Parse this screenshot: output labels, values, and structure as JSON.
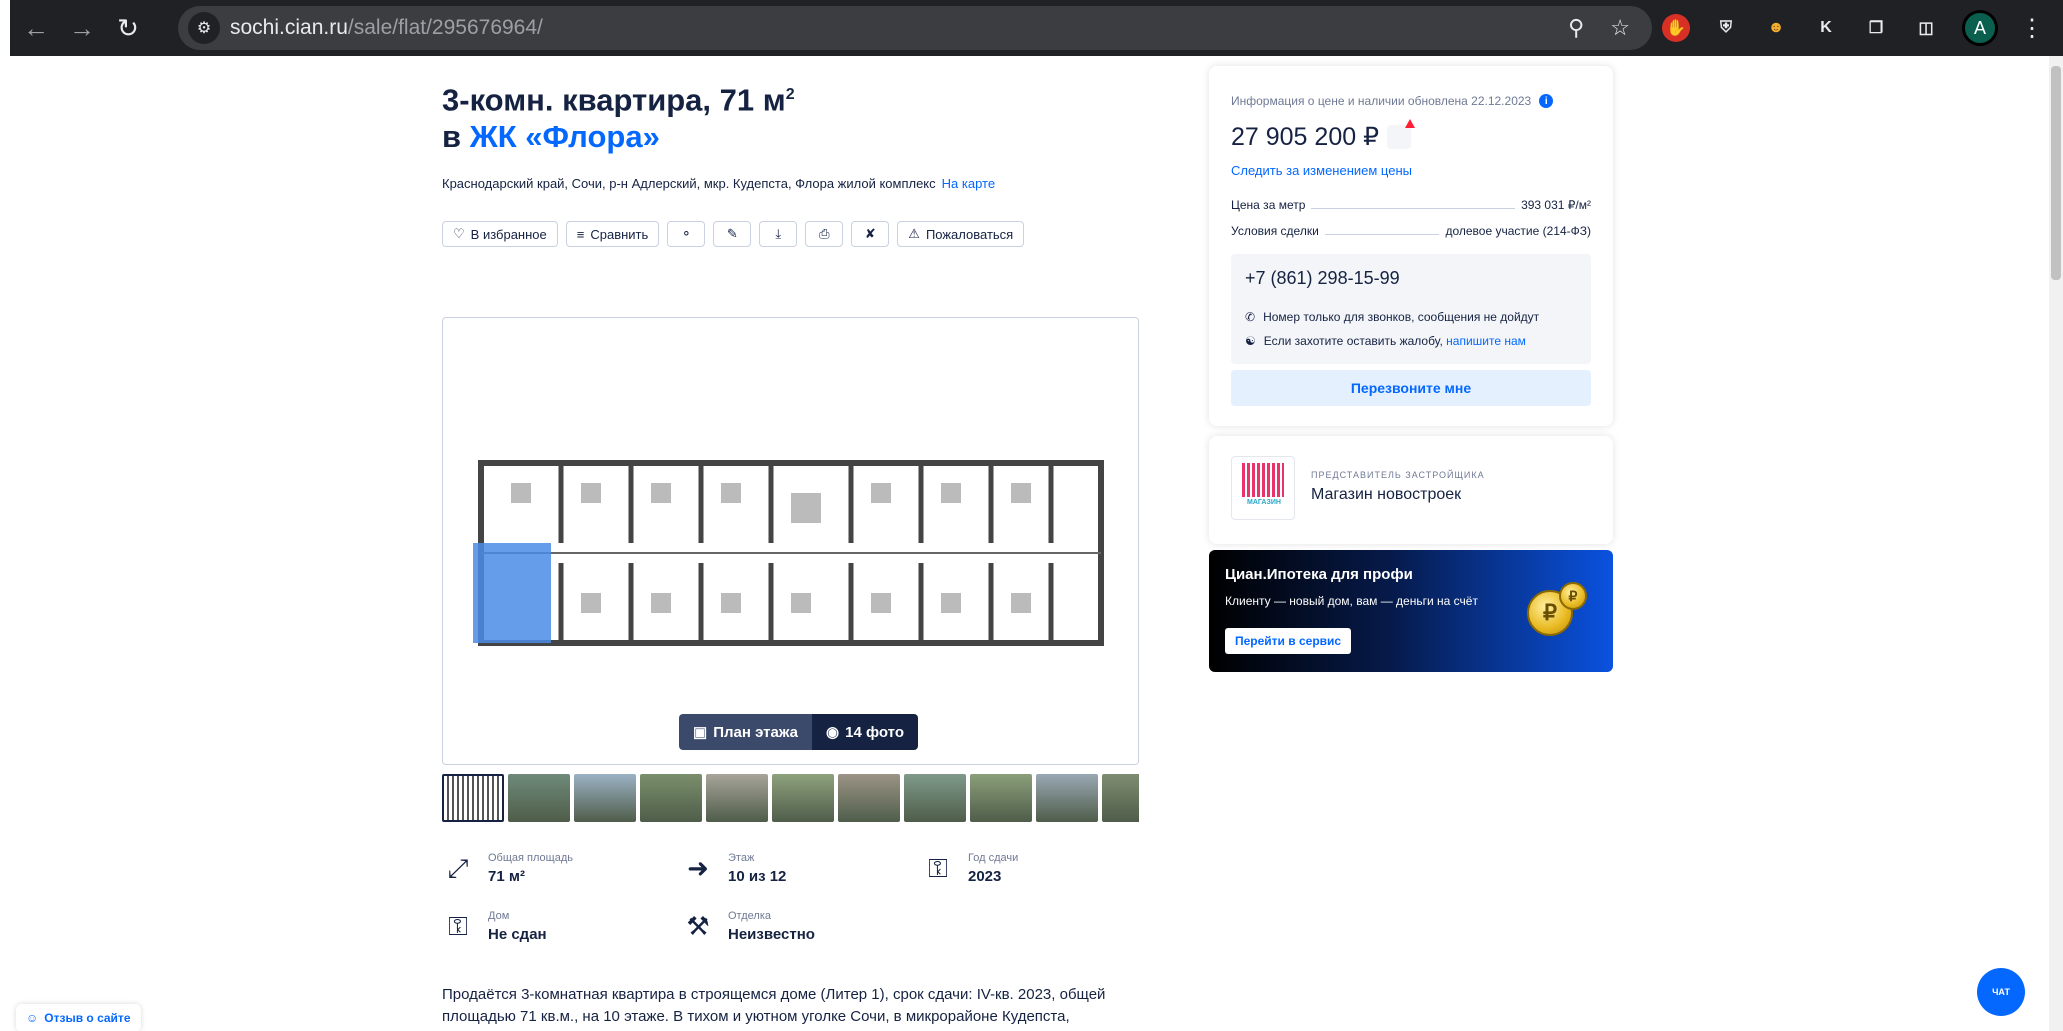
{
  "browser": {
    "url_domain": "sochi.cian.ru",
    "url_path": "/sale/flat/295676964/",
    "extension_k": "K",
    "profile_initial": "A"
  },
  "listing": {
    "title": "3-комн. квартира, 71 м",
    "title_sup": "2",
    "title_prefix": "в",
    "complex_link": "ЖК «Флора»",
    "address": "Краснодарский край, Сочи, р-н Адлерский, мкр. Кудепста, Флора жилой комплекс",
    "map_link": "На карте"
  },
  "actions": {
    "favorite": "В избранное",
    "compare": "Сравнить",
    "complain": "Пожаловаться"
  },
  "gallery": {
    "plan_button": "План этажа",
    "photos_button": "14 фото",
    "thumbnail_colors": [
      "#fff",
      "#6f8a7a",
      "#9bb2c4",
      "#7a8f6b",
      "#a8a49a",
      "#8ea27d",
      "#9c9486",
      "#7f9a8a",
      "#8b9f7a",
      "#9aa8b4",
      "#7e8d70"
    ]
  },
  "facts": [
    {
      "label": "Общая площадь",
      "value": "71 м²",
      "icon": "area-icon"
    },
    {
      "label": "Этаж",
      "value": "10 из 12",
      "icon": "stairs-icon"
    },
    {
      "label": "Год сдачи",
      "value": "2023",
      "icon": "keys-icon"
    },
    {
      "label": "Дом",
      "value": "Не сдан",
      "icon": "house-keys-icon"
    },
    {
      "label": "Отделка",
      "value": "Неизвестно",
      "icon": "tools-icon"
    }
  ],
  "description": "Продаётся 3-комнатная квартира в строящемся доме (Литер 1), срок сдачи: IV-кв. 2023, общей площадью 71 кв.м., на 10 этаже. В тихом и уютном уголке Сочи, в микрорайоне Кудепста, располагается",
  "price_card": {
    "updated": "Информация о цене и наличии обновлена 22.12.2023",
    "price": "27 905 200 ₽",
    "follow": "Следить за изменением цены",
    "per_meter_label": "Цена за метр",
    "per_meter_value": "393 031 ₽/м²",
    "terms_label": "Условия сделки",
    "terms_value": "долевое участие (214-ФЗ)",
    "phone": "+7 (861) 298-15-99",
    "note_calls": "Номер только для звонков, сообщения не дойдут",
    "note_complaint": "Если захотите оставить жалобу,",
    "note_complaint_link": "напишите нам",
    "callback": "Перезвоните мне"
  },
  "developer": {
    "role": "ПРЕДСТАВИТЕЛЬ ЗАСТРОЙЩИКА",
    "name": "Магазин новостроек",
    "logo_text": "МАГАЗИН"
  },
  "promo": {
    "title": "Циан.Ипотека для профи",
    "subtitle": "Клиенту — новый дом, вам — деньги на счёт",
    "button": "Перейти в сервис"
  },
  "feedback": "Отзыв о сайте",
  "chat": "ЧАТ"
}
